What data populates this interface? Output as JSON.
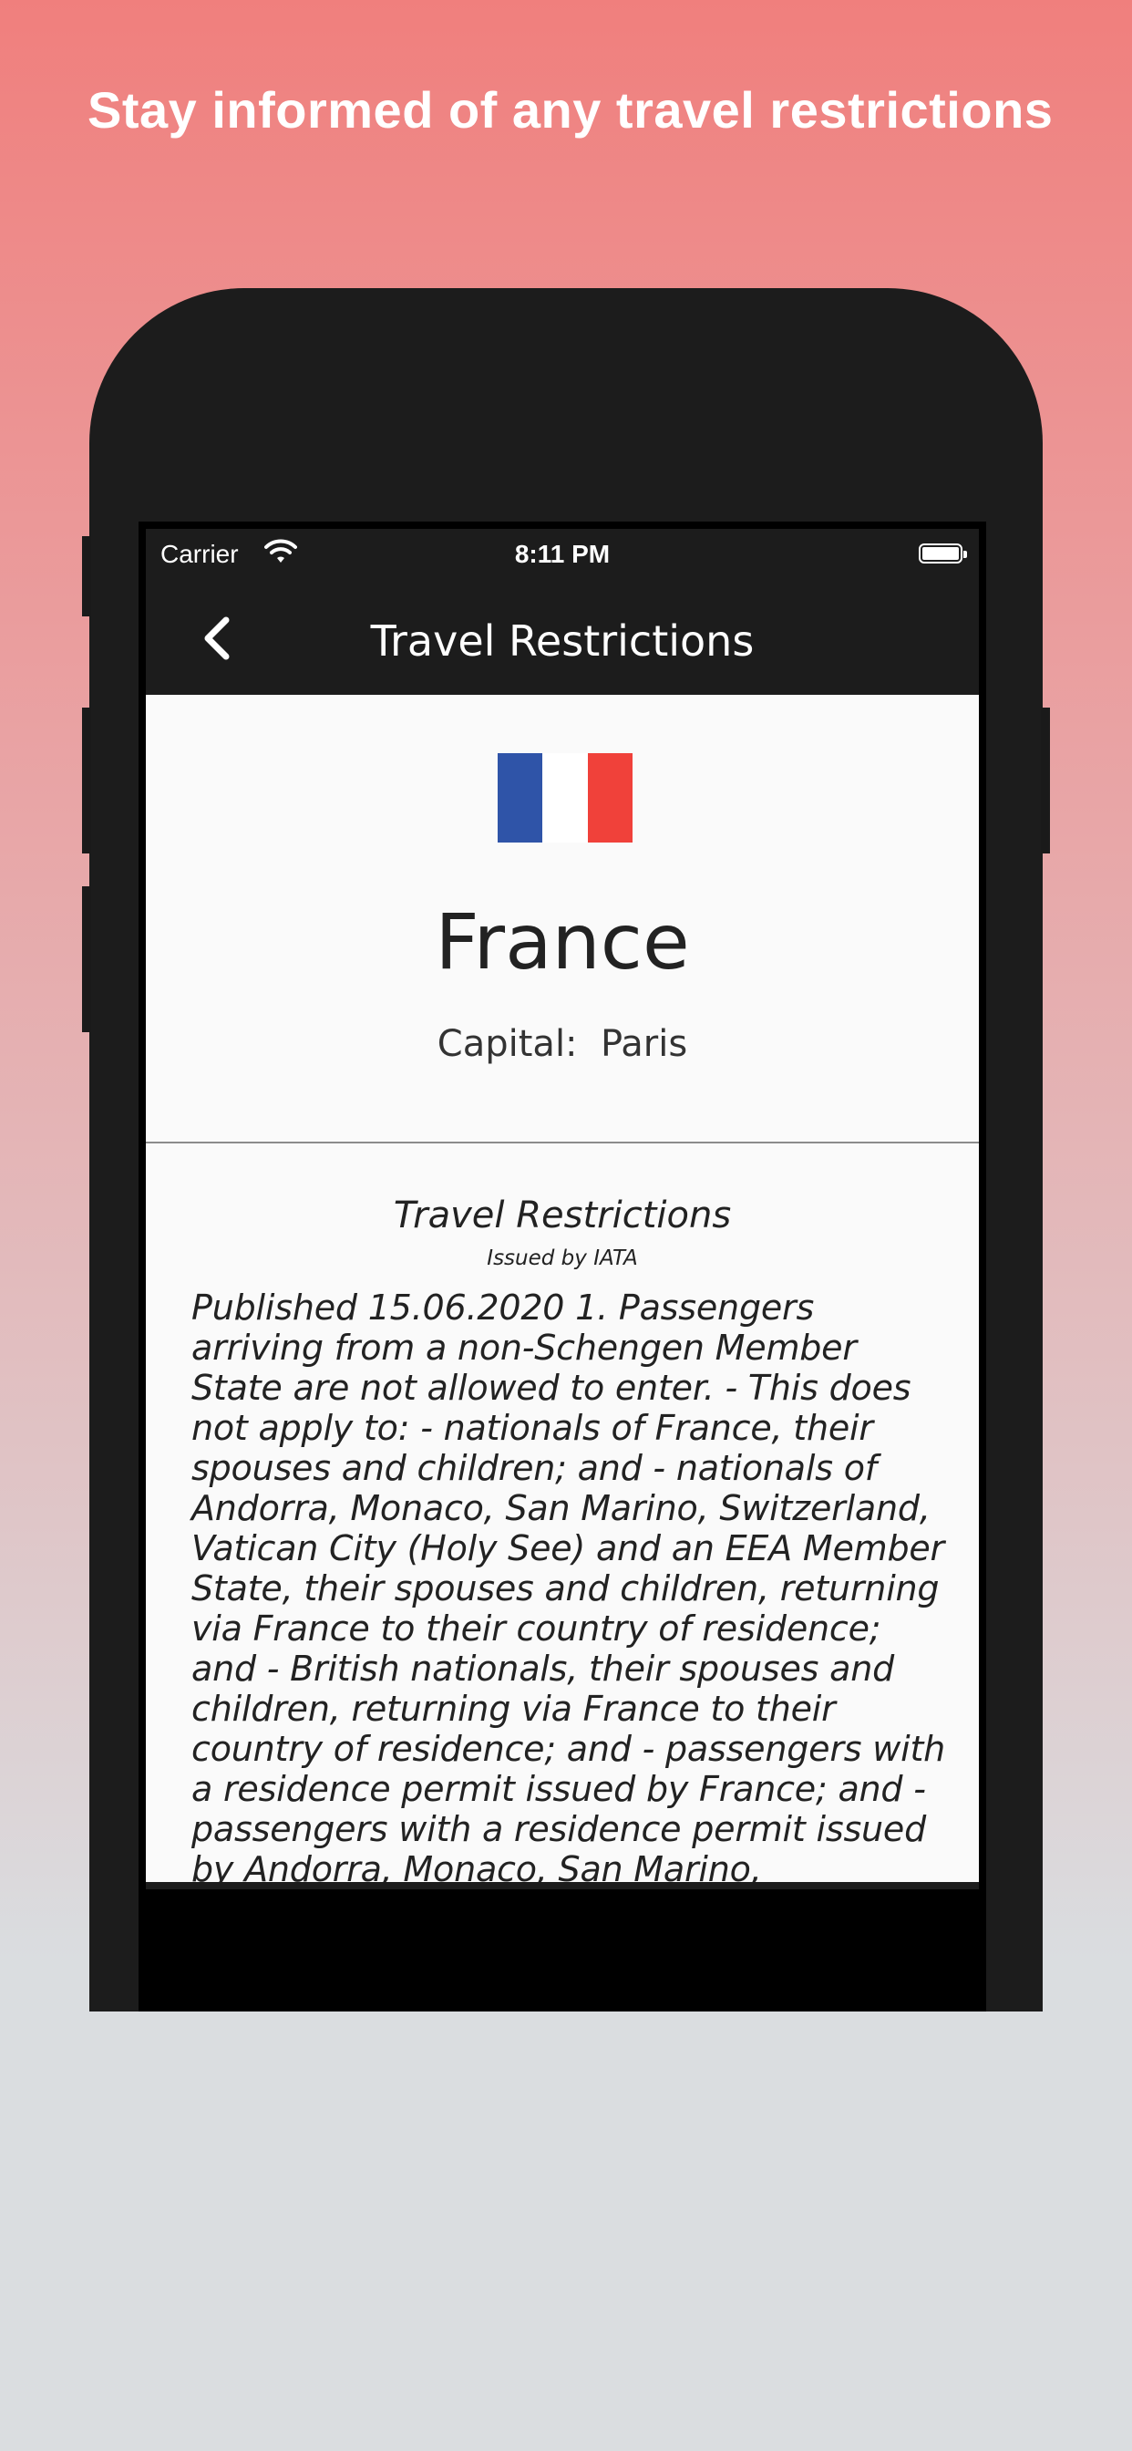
{
  "promo": {
    "headline": "Stay informed of any travel restrictions"
  },
  "status_bar": {
    "carrier": "Carrier",
    "time": "8:11 PM",
    "wifi_icon": "wifi-icon",
    "battery_icon": "battery-icon"
  },
  "nav": {
    "title": "Travel Restrictions",
    "back_icon": "chevron-left-icon"
  },
  "country": {
    "name": "France",
    "capital_label": "Capital:",
    "capital": "Paris",
    "capital_line": "Capital:  Paris",
    "flag_colors": [
      "#2f54a8",
      "#ffffff",
      "#f0413a"
    ]
  },
  "restrictions": {
    "title": "Travel Restrictions",
    "issued_by": "Issued by IATA",
    "text": "Published 15.06.2020 1. Passengers arriving from a non-Schengen Member State are not allowed to enter. - This does not apply to: - nationals of France, their spouses and children; and - nationals of Andorra, Monaco, San Marino, Switzerland, Vatican City (Holy See) and an EEA Member State, their spouses and children, returning via France to their country of residence; and - British nationals, their spouses and children, returning via France to their country of residence; and - passengers with a residence permit issued by France; and - passengers with a residence permit issued by Andorra, Monaco, San Marino,"
  },
  "colors": {
    "bar_background": "#1c1c1c",
    "content_background": "#fafafa"
  }
}
